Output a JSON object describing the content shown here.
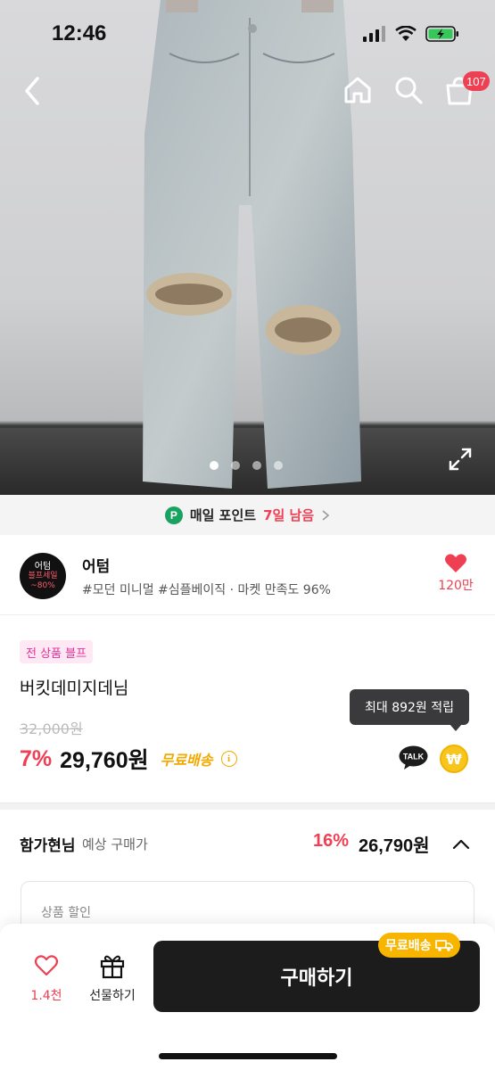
{
  "status_bar": {
    "time": "12:46"
  },
  "nav": {
    "cart_badge": "107"
  },
  "carousel": {
    "total": 4,
    "active": 1
  },
  "point_banner": {
    "label": "매일 포인트",
    "remaining": "7일 남음",
    "badge": "P"
  },
  "store": {
    "logo_line1": "어텀",
    "logo_line2": "블프세일",
    "logo_line3": "~80%",
    "name": "어텀",
    "tags": "#모던 미니멀 #심플베이직 · 마켓 만족도 96%",
    "likes": "120만"
  },
  "product": {
    "sale_tag": "전 상품 블프",
    "name": "버킷데미지데님",
    "original_price": "32,000원",
    "discount": "7%",
    "price": "29,760원",
    "free_shipping": "무료배송",
    "info_icon": "i",
    "talk_label": "TALK",
    "won_symbol": "₩",
    "points_tooltip": "최대 892원 적립"
  },
  "expected": {
    "user": "함가현님",
    "label": "예상 구매가",
    "discount": "16%",
    "price": "26,790원"
  },
  "discount_box": {
    "title": "상품 할인"
  },
  "bottom": {
    "like_count": "1.4천",
    "gift_label": "선물하기",
    "buy_label": "구매하기",
    "ship_chip": "무료배송"
  },
  "colors": {
    "accent_red": "#ef3f52",
    "shipping_yellow": "#f7b500",
    "points_green": "#1aa260",
    "sale_pink": "#e7309a"
  }
}
